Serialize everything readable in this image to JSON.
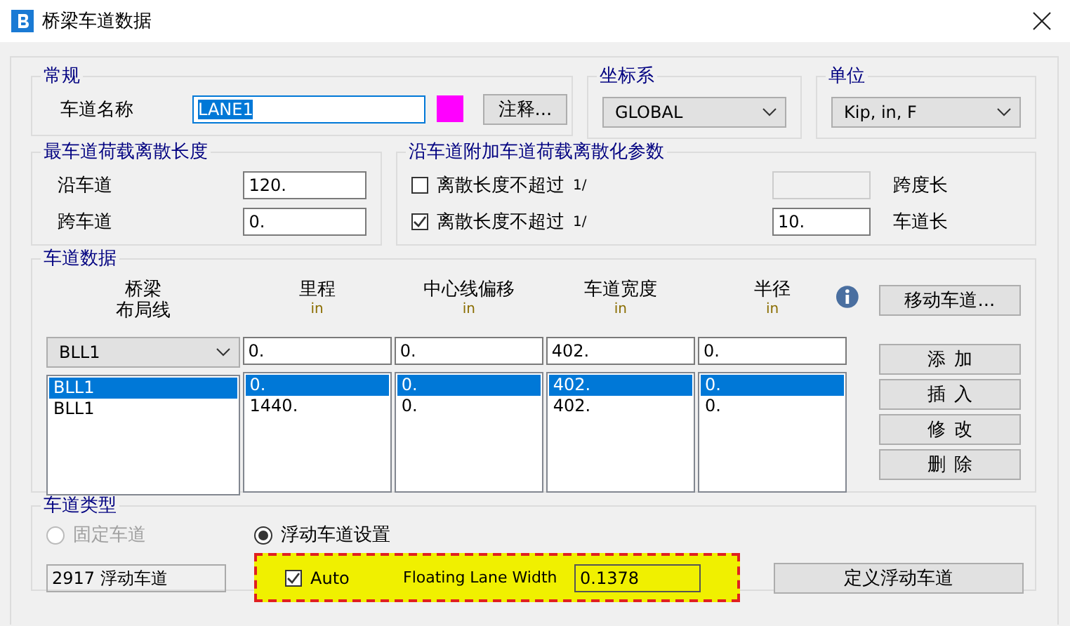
{
  "window": {
    "title": "桥梁车道数据"
  },
  "general": {
    "title": "常规",
    "lane_name_label": "车道名称",
    "lane_name": "LANE1",
    "lane_name_selected": true,
    "color": "#ff00ff",
    "notes_button": "注释..."
  },
  "coordinate_system": {
    "title": "坐标系",
    "value": "GLOBAL"
  },
  "units": {
    "title": "单位",
    "value": "Kip, in, F"
  },
  "discretization": {
    "title": "最车道荷载离散长度",
    "rows": [
      {
        "label": "沿车道",
        "value": "120."
      },
      {
        "label": "跨车道",
        "value": "0."
      }
    ]
  },
  "additional_discretization": {
    "title": "沿车道附加车道荷载离散化参数",
    "rows": [
      {
        "label": "离散长度不超过",
        "fraction": "1/",
        "checked": false,
        "disabled": true,
        "unit": "跨度长"
      },
      {
        "label": "离散长度不超过",
        "fraction": "1/",
        "checked": true,
        "disabled": false,
        "value": "10.",
        "unit": "车道长"
      }
    ]
  },
  "lane_data": {
    "title": "车道数据",
    "columns": [
      {
        "header": [
          "桥梁",
          "布局线"
        ],
        "kind": "dropdown",
        "entry": "BLL1"
      },
      {
        "header": [
          "里程"
        ],
        "unit": "in",
        "kind": "text",
        "entry": "0."
      },
      {
        "header": [
          "中心线偏移"
        ],
        "unit": "in",
        "kind": "text",
        "entry": "0."
      },
      {
        "header": [
          "车道宽度"
        ],
        "unit": "in",
        "kind": "text",
        "entry": "402."
      },
      {
        "header": [
          "半径"
        ],
        "unit": "in",
        "kind": "text",
        "entry": "0."
      }
    ],
    "rows": [
      {
        "cells": [
          "BLL1",
          "0.",
          "0.",
          "402.",
          "0."
        ],
        "selected": true
      },
      {
        "cells": [
          "BLL1",
          "1440.",
          "0.",
          "402.",
          "0."
        ],
        "selected": false
      }
    ],
    "move_button": "移动车道...",
    "buttons": [
      "添加",
      "插入",
      "修改",
      "删除"
    ]
  },
  "lane_type": {
    "title": "车道类型",
    "options": [
      {
        "label": "固定车道",
        "selected": false,
        "disabled": true
      },
      {
        "label": "浮动车道设置",
        "selected": true,
        "disabled": false
      }
    ],
    "fixed_lane_value": "2917 浮动车道",
    "floating": {
      "highlighted": true,
      "auto_label": "Auto",
      "auto_checked": true,
      "width_label": "Floating Lane Width",
      "width_value": "0.1378"
    },
    "define_button": "定义浮动车道"
  }
}
